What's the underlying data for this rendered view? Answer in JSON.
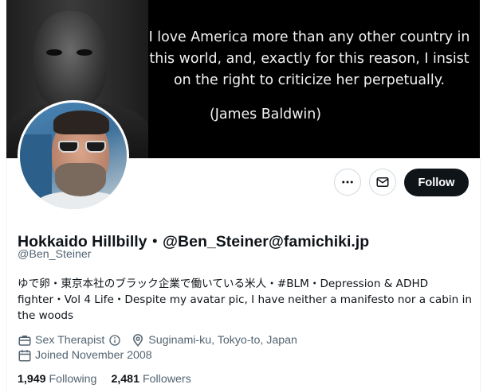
{
  "banner": {
    "quote": "I love America more than any other country in this world, and, exactly for this reason, I insist on the right to criticize her perpetually.",
    "author": "(James Baldwin)"
  },
  "actions": {
    "more_icon": "more-horizontal-icon",
    "message_icon": "envelope-icon",
    "follow_label": "Follow"
  },
  "profile": {
    "display_name": "Hokkaido Hillbilly・@Ben_Steiner@famichiki.jp",
    "handle": "@Ben_Steiner",
    "bio": "ゆで卵・東京本社のブラック企業で働いている米人・#BLM・Depression & ADHD fighter・Vol 4 Life・Despite my avatar pic, I have neither a manifesto nor a cabin in the woods",
    "profession": "Sex Therapist",
    "location": "Suginami-ku, Tokyo-to, Japan",
    "joined": "Joined November 2008"
  },
  "stats": {
    "following_count": "1,949",
    "following_label": "Following",
    "followers_count": "2,481",
    "followers_label": "Followers"
  },
  "colors": {
    "primary_text": "#0f1419",
    "secondary_text": "#536471",
    "border": "#cfd9de",
    "follow_bg": "#0f1419"
  }
}
